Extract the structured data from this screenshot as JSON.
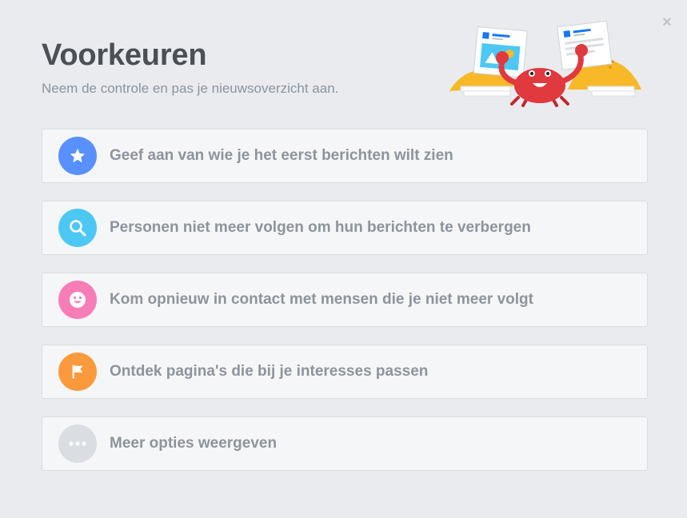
{
  "dialog": {
    "title": "Voorkeuren",
    "subtitle": "Neem de controle en pas je nieuwsoverzicht aan.",
    "close_icon": "×"
  },
  "options": [
    {
      "label": "Geef aan van wie je het eerst berichten wilt zien",
      "icon": "star-icon",
      "color": "#5890ff"
    },
    {
      "label": "Personen niet meer volgen om hun berichten te verbergen",
      "icon": "search-icon",
      "color": "#4dc8f5"
    },
    {
      "label": "Kom opnieuw in contact met mensen die je niet meer volgt",
      "icon": "smiley-icon",
      "color": "#f77db7"
    },
    {
      "label": "Ontdek pagina's die bij je interesses passen",
      "icon": "flag-icon",
      "color": "#fa9a3d"
    },
    {
      "label": "Meer opties weergeven",
      "icon": "more-icon",
      "color": "#dadde1"
    }
  ]
}
